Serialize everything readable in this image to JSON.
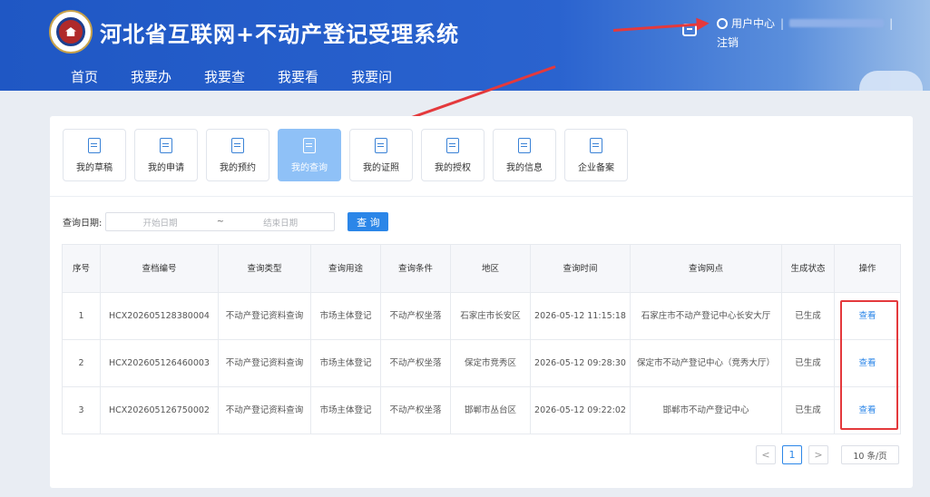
{
  "header": {
    "title": "河北省互联网+不动产登记受理系统",
    "nav": [
      "首页",
      "我要办",
      "我要查",
      "我要看",
      "我要问"
    ],
    "user_center": "用户中心",
    "separator": "|",
    "logout": "注销"
  },
  "tiles": [
    {
      "label": "我的草稿",
      "icon": "document-icon"
    },
    {
      "label": "我的申请",
      "icon": "application-icon"
    },
    {
      "label": "我的预约",
      "icon": "appointment-icon"
    },
    {
      "label": "我的查询",
      "icon": "query-icon",
      "active": true
    },
    {
      "label": "我的证照",
      "icon": "certificate-icon"
    },
    {
      "label": "我的授权",
      "icon": "authorization-icon"
    },
    {
      "label": "我的信息",
      "icon": "info-icon"
    },
    {
      "label": "企业备案",
      "icon": "enterprise-icon"
    }
  ],
  "search": {
    "label": "查询日期:",
    "start_placeholder": "开始日期",
    "tilde": "~",
    "end_placeholder": "结束日期",
    "button": "查 询"
  },
  "table": {
    "headers": [
      "序号",
      "查档编号",
      "查询类型",
      "查询用途",
      "查询条件",
      "地区",
      "查询时间",
      "查询网点",
      "生成状态",
      "操作"
    ],
    "rows": [
      [
        "1",
        "HCX202605128380004",
        "不动产登记资料查询",
        "市场主体登记",
        "不动产权坐落",
        "石家庄市长安区",
        "2026-05-12 11:15:18",
        "石家庄市不动产登记中心长安大厅",
        "已生成",
        "查看"
      ],
      [
        "2",
        "HCX202605126460003",
        "不动产登记资料查询",
        "市场主体登记",
        "不动产权坐落",
        "保定市竞秀区",
        "2026-05-12 09:28:30",
        "保定市不动产登记中心（竞秀大厅）",
        "已生成",
        "查看"
      ],
      [
        "3",
        "HCX202605126750002",
        "不动产登记资料查询",
        "市场主体登记",
        "不动产权坐落",
        "邯郸市丛台区",
        "2026-05-12 09:22:02",
        "邯郸市不动产登记中心",
        "已生成",
        "查看"
      ]
    ]
  },
  "pagination": {
    "prev": "<",
    "current": "1",
    "next": ">",
    "page_size": "10 条/页"
  },
  "colors": {
    "primary": "#2b86e8",
    "header": "#1f57c4",
    "annotation": "#e4393c",
    "active_tile": "#8fc1f7"
  }
}
